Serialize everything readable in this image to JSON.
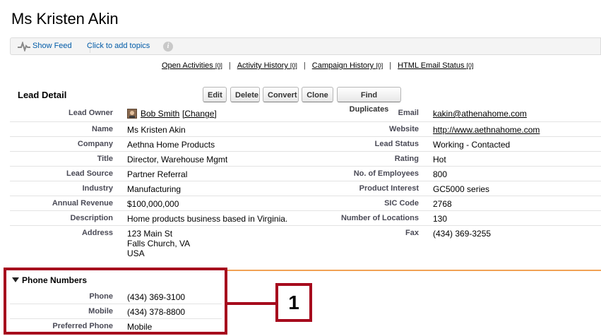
{
  "page": {
    "title": "Ms Kristen Akin"
  },
  "feed": {
    "show_feed": "Show Feed",
    "add_topics": "Click to add topics",
    "info_glyph": "i"
  },
  "related": [
    {
      "label": "Open Activities",
      "count": "[0]"
    },
    {
      "label": "Activity History",
      "count": "[0]"
    },
    {
      "label": "Campaign History",
      "count": "[0]"
    },
    {
      "label": "HTML Email Status",
      "count": "[0]"
    }
  ],
  "detail": {
    "title": "Lead Detail",
    "buttons": [
      "Edit",
      "Delete",
      "Convert",
      "Clone",
      "Find Duplicates"
    ]
  },
  "fields": {
    "lead_owner": {
      "label": "Lead Owner",
      "value": "Bob Smith",
      "change": "[Change]"
    },
    "name": {
      "label": "Name",
      "value": "Ms Kristen Akin"
    },
    "company": {
      "label": "Company",
      "value": "Aethna Home Products"
    },
    "title": {
      "label": "Title",
      "value": "Director, Warehouse Mgmt"
    },
    "lead_source": {
      "label": "Lead Source",
      "value": "Partner Referral"
    },
    "industry": {
      "label": "Industry",
      "value": "Manufacturing"
    },
    "annual_revenue": {
      "label": "Annual Revenue",
      "value": "$100,000,000"
    },
    "description": {
      "label": "Description",
      "value": "Home products business based in Virginia."
    },
    "address": {
      "label": "Address",
      "line1": "123 Main St",
      "line2": "Falls Church, VA",
      "line3": "USA"
    },
    "email": {
      "label": "Email",
      "value": "kakin@athenahome.com"
    },
    "website": {
      "label": "Website",
      "value": "http://www.aethnahome.com"
    },
    "lead_status": {
      "label": "Lead Status",
      "value": "Working - Contacted"
    },
    "rating": {
      "label": "Rating",
      "value": "Hot"
    },
    "employees": {
      "label": "No. of Employees",
      "value": "800"
    },
    "product_interest": {
      "label": "Product Interest",
      "value": "GC5000 series"
    },
    "sic_code": {
      "label": "SIC Code",
      "value": "2768"
    },
    "locations": {
      "label": "Number of Locations",
      "value": "130"
    },
    "fax": {
      "label": "Fax",
      "value": "(434) 369-3255"
    }
  },
  "phone_section": {
    "title": "Phone Numbers",
    "phone": {
      "label": "Phone",
      "value": "(434) 369-3100"
    },
    "mobile": {
      "label": "Mobile",
      "value": "(434) 378-8800"
    },
    "preferred": {
      "label": "Preferred Phone",
      "value": "Mobile"
    }
  },
  "callout": {
    "number": "1"
  },
  "colors": {
    "link": "#015ba7",
    "label": "#4a4a56",
    "callout": "#a6091d",
    "section_rule": "#f1a254"
  }
}
